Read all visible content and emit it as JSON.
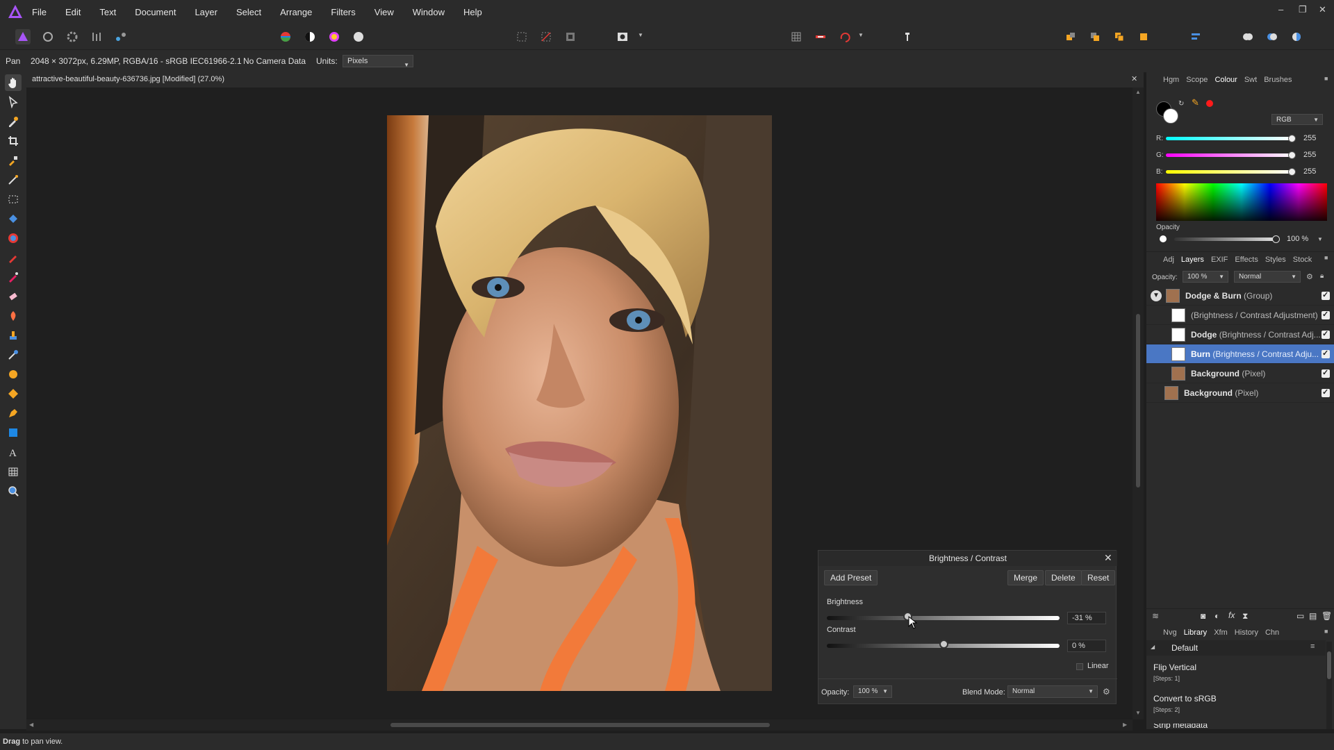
{
  "menu": [
    "File",
    "Edit",
    "Text",
    "Document",
    "Layer",
    "Select",
    "Arrange",
    "Filters",
    "View",
    "Window",
    "Help"
  ],
  "window_controls": {
    "minimize": "–",
    "restore": "❐",
    "close": "✕"
  },
  "context": {
    "tool": "Pan",
    "doc_info": "2048 × 3072px, 6.29MP, RGBA/16 - sRGB IEC61966-2.1",
    "camera": "No Camera Data",
    "units_label": "Units:",
    "units_value": "Pixels"
  },
  "doc_tab": {
    "title": "attractive-beautiful-beauty-636736.jpg [Modified] (27.0%)"
  },
  "colour_panel": {
    "tabs": [
      "Hgm",
      "Scope",
      "Colour",
      "Swt",
      "Brushes"
    ],
    "active_tab": "Colour",
    "model": "RGB",
    "r_label": "R:",
    "r": "255",
    "g_label": "G:",
    "g": "255",
    "b_label": "B:",
    "b": "255",
    "opacity_label": "Opacity",
    "opacity": "100 %",
    "pick_color": "#ff1a1a"
  },
  "layers_panel": {
    "tabs": [
      "Adj",
      "Layers",
      "EXIF",
      "Effects",
      "Styles",
      "Stock"
    ],
    "active_tab": "Layers",
    "opacity_label": "Opacity:",
    "opacity": "100 %",
    "blend": "Normal",
    "layers": [
      {
        "name": "Dodge & Burn",
        "type": "(Group)"
      },
      {
        "name": "",
        "type": "(Brightness / Contrast Adjustment)"
      },
      {
        "name": "Dodge",
        "type": "(Brightness / Contrast Adj..."
      },
      {
        "name": "Burn",
        "type": "(Brightness / Contrast Adju..."
      },
      {
        "name": "Background",
        "type": "(Pixel)"
      },
      {
        "name": "Background",
        "type": "(Pixel)"
      }
    ]
  },
  "library_panel": {
    "tabs": [
      "Nvg",
      "Library",
      "Xfm",
      "History",
      "Chn"
    ],
    "active_tab": "Library",
    "category": "Default",
    "items": [
      {
        "name": "Flip Vertical",
        "steps": "[Steps: 1]"
      },
      {
        "name": "Convert to sRGB",
        "steps": "[Steps: 2]"
      },
      {
        "name": "Strip metadata",
        "steps": ""
      }
    ]
  },
  "adjustment": {
    "title": "Brightness / Contrast",
    "add_preset": "Add Preset",
    "merge": "Merge",
    "delete": "Delete",
    "reset": "Reset",
    "brightness_label": "Brightness",
    "brightness_value": "-31 %",
    "brightness_fraction": 0.345,
    "contrast_label": "Contrast",
    "contrast_value": "0 %",
    "contrast_fraction": 0.5,
    "linear_label": "Linear",
    "opacity_label": "Opacity:",
    "opacity_value": "100 %",
    "blend_label": "Blend Mode:",
    "blend_value": "Normal"
  },
  "status": {
    "bold": "Drag",
    "text": "to pan view."
  }
}
